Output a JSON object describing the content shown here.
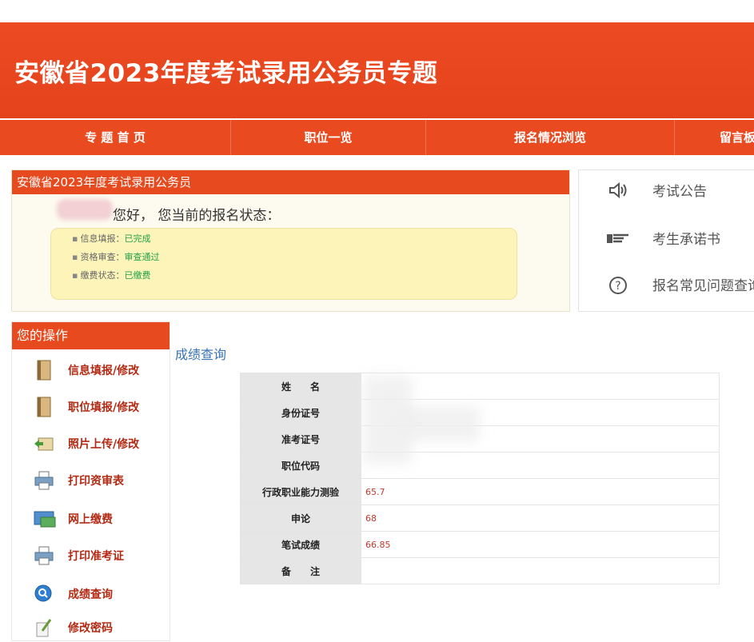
{
  "banner": {
    "title": "安徽省2023年度考试录用公务员专题"
  },
  "nav": {
    "items": [
      {
        "label": "专 题 首 页"
      },
      {
        "label": "职位一览"
      },
      {
        "label": "报名情况浏览"
      },
      {
        "label": "留言板"
      }
    ]
  },
  "status_panel": {
    "header": "安徽省2023年度考试录用公务员",
    "greeting": "您好， 您当前的报名状态：",
    "rows": [
      {
        "label": "信息填报：",
        "value": "已完成"
      },
      {
        "label": "资格审查：",
        "value": "审查通过"
      },
      {
        "label": "缴费状态：",
        "value": "已缴费"
      }
    ]
  },
  "quick_links": [
    {
      "label": "考试公告",
      "icon": "speaker-icon"
    },
    {
      "label": "考生承诺书",
      "icon": "hand-pointer-icon"
    },
    {
      "label": "报名常见问题查询",
      "icon": "question-circle-icon"
    }
  ],
  "operations": {
    "header": "您的操作",
    "items": [
      {
        "label": "信息填报/修改",
        "icon": "book-icon"
      },
      {
        "label": "职位填报/修改",
        "icon": "book-icon"
      },
      {
        "label": "照片上传/修改",
        "icon": "photo-upload-icon"
      },
      {
        "label": "打印资审表",
        "icon": "printer-icon"
      },
      {
        "label": "网上缴费",
        "icon": "payment-card-icon"
      },
      {
        "label": "打印准考证",
        "icon": "printer-icon"
      },
      {
        "label": "成绩查询",
        "icon": "magnifier-icon"
      },
      {
        "label": "修改密码",
        "icon": "pencil-paper-icon"
      }
    ]
  },
  "score": {
    "title": "成绩查询",
    "rows": [
      {
        "label": "姓　　名",
        "value": ""
      },
      {
        "label": "身份证号",
        "value": ""
      },
      {
        "label": "准考证号",
        "value": ""
      },
      {
        "label": "职位代码",
        "value": ""
      },
      {
        "label": "行政职业能力测验",
        "value": "65.7"
      },
      {
        "label": "申论",
        "value": "68"
      },
      {
        "label": "笔试成绩",
        "value": "66.85"
      },
      {
        "label": "备　　注",
        "value": ""
      }
    ]
  },
  "colors": {
    "brand_red": "#e64a1e",
    "status_green": "#22a14a",
    "score_red": "#c0392b",
    "link_blue": "#3873b3"
  }
}
